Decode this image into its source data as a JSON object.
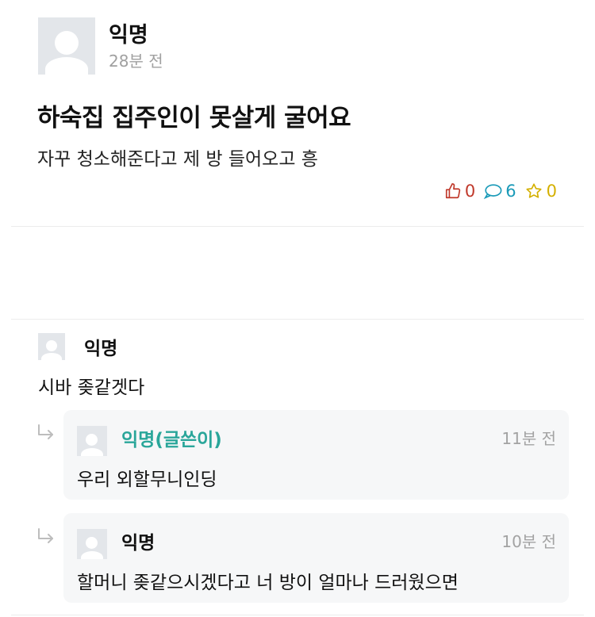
{
  "post": {
    "author": "익명",
    "time": "28분 전",
    "title": "하숙집 집주인이 못살게 굴어요",
    "body": "자꾸 청소해준다고 제 방 들어오고 흥",
    "likes": "0",
    "comments": "6",
    "scraps": "0"
  },
  "comments": [
    {
      "author": "익명",
      "text": "시바 좆같겟다"
    }
  ],
  "replies": [
    {
      "author": "익명(글쓴이)",
      "time": "11분 전",
      "text": "우리 외할무니인딩",
      "is_op": true
    },
    {
      "author": "익명",
      "time": "10분 전",
      "text": "할머니 좆같으시겠다고 너 방이 얼마나 드러웠으면",
      "is_op": false
    }
  ],
  "icons": {
    "like": "thumbs-up-icon",
    "comment": "speech-bubble-icon",
    "scrap": "star-icon",
    "reply": "reply-arrow-icon"
  },
  "colors": {
    "like": "#c0392b",
    "comment": "#1a9ab8",
    "scrap": "#d4b000",
    "op_author": "#2aa69a"
  }
}
